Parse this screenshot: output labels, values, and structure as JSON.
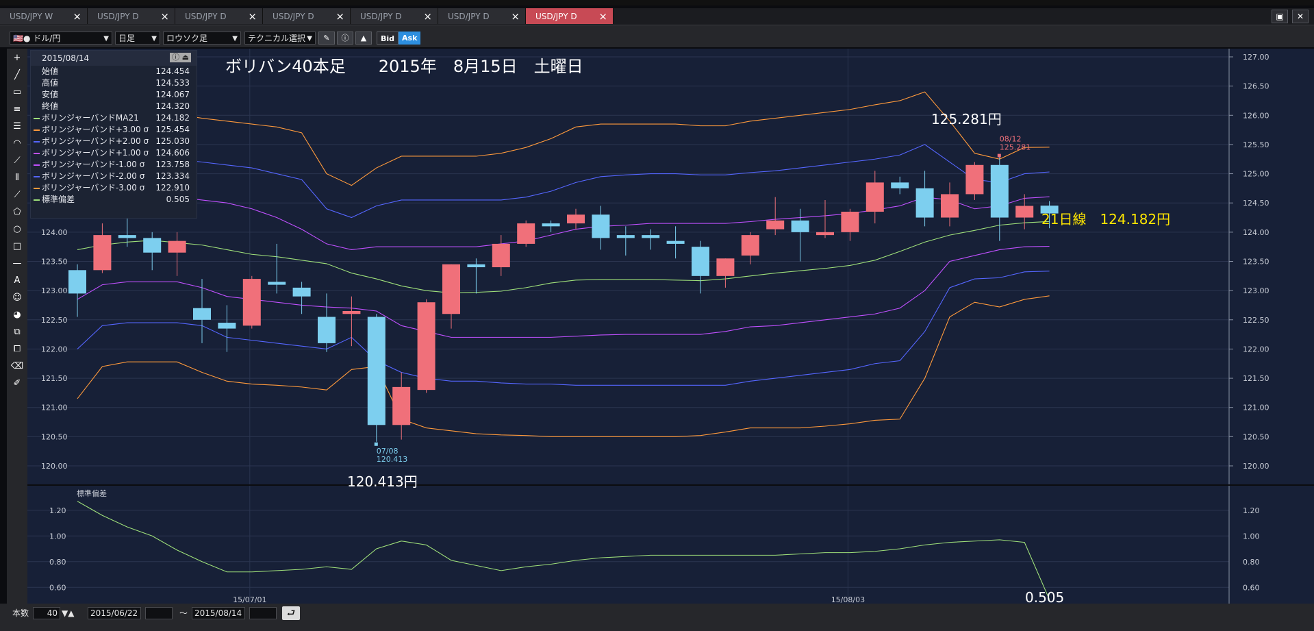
{
  "tabs": [
    {
      "label": "USD/JPY W",
      "active": false
    },
    {
      "label": "USD/JPY D",
      "active": false
    },
    {
      "label": "USD/JPY D",
      "active": false
    },
    {
      "label": "USD/JPY D",
      "active": false
    },
    {
      "label": "USD/JPY D",
      "active": false
    },
    {
      "label": "USD/JPY D",
      "active": false
    },
    {
      "label": "USD/JPY D",
      "active": true
    }
  ],
  "toolbar": {
    "pair": "ドル/円",
    "period": "日足",
    "chart_type": "ロウソク足",
    "technical": "テクニカル選択",
    "bid": "Bid",
    "ask": "Ask"
  },
  "info_panel": {
    "date": "2015/08/14",
    "rows": [
      {
        "label": "始値",
        "value": "124.454",
        "color": ""
      },
      {
        "label": "高値",
        "value": "124.533",
        "color": ""
      },
      {
        "label": "安値",
        "value": "124.067",
        "color": ""
      },
      {
        "label": "終値",
        "value": "124.320",
        "color": ""
      },
      {
        "label": "ボリンジャーバンドMA21",
        "value": "124.182",
        "color": "#9fe07a"
      },
      {
        "label": "ボリンジャーバンド+3.00 σ",
        "value": "125.454",
        "color": "#ff9a3c"
      },
      {
        "label": "ボリンジャーバンド+2.00 σ",
        "value": "125.030",
        "color": "#5566ff"
      },
      {
        "label": "ボリンジャーバンド+1.00 σ",
        "value": "124.606",
        "color": "#c050ff"
      },
      {
        "label": "ボリンジャーバンド-1.00 σ",
        "value": "123.758",
        "color": "#c050ff"
      },
      {
        "label": "ボリンジャーバンド-2.00 σ",
        "value": "123.334",
        "color": "#5566ff"
      },
      {
        "label": "ボリンジャーバンド-3.00 σ",
        "value": "122.910",
        "color": "#ff9a3c"
      },
      {
        "label": "標準偏差",
        "value": "0.505",
        "color": "#9fe07a"
      }
    ]
  },
  "annotations": {
    "title": "ボリバン40本足　　2015年　8月15日　土曜日",
    "high_label": "125.281円",
    "high_marker_date": "08/12",
    "high_marker_value": "125.281",
    "low_label": "120.413円",
    "low_marker_date": "07/08",
    "low_marker_value": "120.413",
    "ma_label": "21日線　124.182円",
    "sd_label": "0.505"
  },
  "bottom": {
    "count_label": "本数",
    "count_value": "40",
    "from_date": "2015/06/22",
    "tilde": "〜",
    "to_date": "2015/08/14"
  },
  "colors": {
    "up": "#f0707a",
    "down": "#7dcfef",
    "ma": "#9fe07a",
    "band3": "#ff9a3c",
    "band2": "#5566ff",
    "band1": "#c050ff",
    "sd": "#9fe07a",
    "title": "#ffffff",
    "ma_label": "#ffe600"
  },
  "chart_data": {
    "type": "candlestick",
    "yaxis": {
      "min": 120.0,
      "max": 127.0,
      "ticks": [
        "120.00",
        "120.50",
        "121.00",
        "121.50",
        "122.00",
        "122.50",
        "123.00",
        "123.50",
        "124.00",
        "124.50",
        "125.00",
        "125.50",
        "126.00",
        "126.50",
        "127.00"
      ]
    },
    "x_tick_labels": [
      {
        "index": 7,
        "label": "15/07/01"
      },
      {
        "index": 31,
        "label": "15/08/03"
      }
    ],
    "ohlc": [
      [
        123.35,
        123.45,
        122.55,
        122.95
      ],
      [
        123.35,
        124.15,
        123.3,
        123.95
      ],
      [
        123.95,
        124.25,
        123.75,
        123.9
      ],
      [
        123.9,
        124.0,
        123.35,
        123.65
      ],
      [
        123.65,
        124.0,
        123.25,
        123.85
      ],
      [
        122.7,
        123.2,
        122.1,
        122.5
      ],
      [
        122.45,
        122.75,
        121.95,
        122.35
      ],
      [
        122.4,
        123.25,
        122.35,
        123.2
      ],
      [
        123.15,
        123.8,
        122.95,
        123.1
      ],
      [
        123.05,
        123.15,
        122.6,
        122.9
      ],
      [
        122.55,
        122.95,
        121.95,
        122.1
      ],
      [
        122.6,
        122.9,
        122.05,
        122.65
      ],
      [
        122.55,
        122.6,
        120.413,
        120.7
      ],
      [
        120.7,
        121.6,
        120.45,
        121.35
      ],
      [
        121.3,
        122.85,
        121.25,
        122.8
      ],
      [
        122.6,
        123.45,
        122.35,
        123.45
      ],
      [
        123.45,
        123.55,
        122.95,
        123.4
      ],
      [
        123.4,
        123.95,
        123.25,
        123.8
      ],
      [
        123.8,
        124.2,
        123.75,
        124.15
      ],
      [
        124.15,
        124.2,
        124.0,
        124.1
      ],
      [
        124.15,
        124.4,
        124.05,
        124.3
      ],
      [
        124.3,
        124.45,
        123.7,
        123.9
      ],
      [
        123.95,
        124.1,
        123.6,
        123.9
      ],
      [
        123.95,
        124.05,
        123.7,
        123.9
      ],
      [
        123.85,
        124.1,
        123.55,
        123.8
      ],
      [
        123.75,
        123.85,
        122.95,
        123.25
      ],
      [
        123.25,
        123.55,
        123.05,
        123.55
      ],
      [
        123.6,
        124.0,
        123.45,
        123.95
      ],
      [
        124.05,
        124.6,
        123.95,
        124.2
      ],
      [
        124.2,
        124.4,
        123.5,
        124.0
      ],
      [
        123.95,
        124.55,
        123.9,
        124.0
      ],
      [
        124.0,
        124.4,
        123.85,
        124.35
      ],
      [
        124.35,
        125.05,
        124.15,
        124.85
      ],
      [
        124.85,
        124.95,
        124.65,
        124.75
      ],
      [
        124.75,
        125.05,
        124.1,
        124.25
      ],
      [
        124.25,
        124.85,
        124.1,
        124.65
      ],
      [
        124.65,
        125.2,
        124.55,
        125.15
      ],
      [
        125.15,
        125.281,
        123.85,
        124.25
      ],
      [
        124.25,
        124.65,
        124.05,
        124.45
      ],
      [
        124.454,
        124.533,
        124.067,
        124.32
      ]
    ],
    "ma21": [
      123.7,
      123.78,
      123.83,
      123.86,
      123.82,
      123.78,
      123.7,
      123.62,
      123.58,
      123.52,
      123.46,
      123.3,
      123.2,
      123.08,
      123.0,
      122.96,
      122.97,
      122.99,
      123.05,
      123.13,
      123.18,
      123.19,
      123.19,
      123.19,
      123.18,
      123.17,
      123.2,
      123.25,
      123.3,
      123.34,
      123.38,
      123.43,
      123.52,
      123.67,
      123.83,
      123.95,
      124.03,
      124.12,
      124.16,
      124.182
    ],
    "band_plus3": [
      126.15,
      126.15,
      126.1,
      126.05,
      126.02,
      125.95,
      125.9,
      125.85,
      125.8,
      125.7,
      125.0,
      124.8,
      125.1,
      125.3,
      125.3,
      125.3,
      125.3,
      125.35,
      125.45,
      125.6,
      125.8,
      125.85,
      125.85,
      125.85,
      125.85,
      125.82,
      125.82,
      125.9,
      125.95,
      126.0,
      126.05,
      126.1,
      126.18,
      126.25,
      126.4,
      125.9,
      125.35,
      125.25,
      125.45,
      125.454
    ],
    "band_plus2": [
      125.5,
      125.4,
      125.35,
      125.3,
      125.25,
      125.2,
      125.15,
      125.1,
      125.0,
      124.9,
      124.4,
      124.25,
      124.45,
      124.55,
      124.55,
      124.55,
      124.55,
      124.55,
      124.6,
      124.7,
      124.85,
      124.95,
      124.98,
      125.0,
      125.0,
      124.98,
      124.98,
      125.02,
      125.05,
      125.1,
      125.15,
      125.2,
      125.25,
      125.32,
      125.5,
      125.2,
      124.9,
      124.85,
      125.0,
      125.03
    ],
    "band_plus1": [
      124.8,
      124.8,
      124.75,
      124.7,
      124.6,
      124.55,
      124.5,
      124.4,
      124.25,
      124.05,
      123.8,
      123.7,
      123.75,
      123.75,
      123.75,
      123.75,
      123.75,
      123.8,
      123.85,
      123.95,
      124.05,
      124.1,
      124.12,
      124.15,
      124.15,
      124.15,
      124.15,
      124.18,
      124.22,
      124.25,
      124.28,
      124.32,
      124.38,
      124.45,
      124.6,
      124.55,
      124.4,
      124.45,
      124.58,
      124.606
    ],
    "band_minus1": [
      122.85,
      123.1,
      123.15,
      123.15,
      123.15,
      123.05,
      122.9,
      122.85,
      122.8,
      122.75,
      122.72,
      122.7,
      122.65,
      122.4,
      122.3,
      122.2,
      122.2,
      122.2,
      122.2,
      122.2,
      122.22,
      122.24,
      122.25,
      122.25,
      122.25,
      122.25,
      122.3,
      122.38,
      122.4,
      122.45,
      122.5,
      122.55,
      122.6,
      122.7,
      123.0,
      123.5,
      123.6,
      123.7,
      123.75,
      123.758
    ],
    "band_minus2": [
      122.0,
      122.4,
      122.45,
      122.45,
      122.45,
      122.4,
      122.2,
      122.15,
      122.1,
      122.05,
      122.0,
      122.2,
      121.8,
      121.6,
      121.5,
      121.45,
      121.45,
      121.42,
      121.4,
      121.4,
      121.38,
      121.38,
      121.38,
      121.38,
      121.38,
      121.38,
      121.38,
      121.45,
      121.5,
      121.55,
      121.6,
      121.65,
      121.75,
      121.8,
      122.3,
      123.05,
      123.2,
      123.22,
      123.32,
      123.334
    ],
    "band_minus3": [
      121.15,
      121.7,
      121.78,
      121.78,
      121.78,
      121.6,
      121.45,
      121.4,
      121.38,
      121.35,
      121.3,
      121.65,
      121.7,
      120.8,
      120.65,
      120.6,
      120.55,
      120.53,
      120.52,
      120.5,
      120.5,
      120.5,
      120.5,
      120.5,
      120.5,
      120.52,
      120.58,
      120.65,
      120.65,
      120.65,
      120.68,
      120.72,
      120.78,
      120.8,
      121.5,
      122.55,
      122.8,
      122.72,
      122.85,
      122.91
    ],
    "stddev": {
      "min": 0.5,
      "max": 1.3,
      "ticks": [
        "0.60",
        "0.80",
        "1.00",
        "1.20"
      ],
      "values": [
        1.27,
        1.16,
        1.07,
        1.0,
        0.89,
        0.8,
        0.72,
        0.72,
        0.73,
        0.74,
        0.76,
        0.74,
        0.9,
        0.96,
        0.93,
        0.81,
        0.77,
        0.73,
        0.76,
        0.78,
        0.81,
        0.83,
        0.84,
        0.85,
        0.85,
        0.85,
        0.85,
        0.85,
        0.85,
        0.86,
        0.87,
        0.87,
        0.88,
        0.9,
        0.93,
        0.95,
        0.96,
        0.97,
        0.95,
        0.505
      ]
    }
  }
}
